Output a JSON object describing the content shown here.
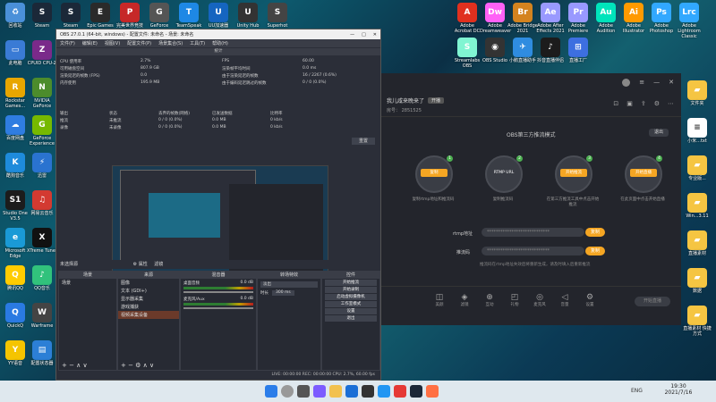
{
  "desktop_left": [
    {
      "label": "回收站",
      "color": "#4a90d9",
      "glyph": "♻"
    },
    {
      "label": "Steam",
      "color": "#1b2838",
      "glyph": "S"
    },
    {
      "label": "此电脑",
      "color": "#3a7bd5",
      "glyph": "▭"
    },
    {
      "label": "CPUID CPU-Z",
      "color": "#7a2a8a",
      "glyph": "Z"
    },
    {
      "label": "Rockstar Games...",
      "color": "#e8a600",
      "glyph": "R"
    },
    {
      "label": "NVIDIA GeForce",
      "color": "#4c8c2c",
      "glyph": "N"
    },
    {
      "label": "百度网盘",
      "color": "#2f7de1",
      "glyph": "☁"
    },
    {
      "label": "GeForce Experience",
      "color": "#76b900",
      "glyph": "G"
    },
    {
      "label": "酷狗音乐",
      "color": "#1e8bdb",
      "glyph": "K"
    },
    {
      "label": "迅雷",
      "color": "#2a73d0",
      "glyph": "⚡"
    },
    {
      "label": "Studio One V3.5",
      "color": "#1c1c1c",
      "glyph": "S1"
    },
    {
      "label": "网易云音乐",
      "color": "#d33a31",
      "glyph": "♫"
    },
    {
      "label": "Microsoft Edge",
      "color": "#1a9ad6",
      "glyph": "e"
    },
    {
      "label": "XTreme Tuner",
      "color": "#111",
      "glyph": "X"
    },
    {
      "label": "腾讯QQ",
      "color": "#ffcc00",
      "glyph": "Q"
    },
    {
      "label": "QQ音乐",
      "color": "#31c27c",
      "glyph": "♪"
    },
    {
      "label": "QuickQ",
      "color": "#2a7ae2",
      "glyph": "Q"
    },
    {
      "label": "Warframe",
      "color": "#444",
      "glyph": "W"
    },
    {
      "label": "YY语音",
      "color": "#f5c400",
      "glyph": "Y"
    },
    {
      "label": "配置状态器",
      "color": "#2c7fd6",
      "glyph": "▤"
    }
  ],
  "desktop_top": [
    {
      "label": "Steam",
      "color": "#1b2838",
      "glyph": "S"
    },
    {
      "label": "Epic Games",
      "color": "#2a2a2a",
      "glyph": "E"
    },
    {
      "label": "完美世界竞技平台",
      "color": "#c62828",
      "glyph": "P"
    },
    {
      "label": "GeForce",
      "color": "#555",
      "glyph": "G"
    },
    {
      "label": "TeamSpeak",
      "color": "#1e88e5",
      "glyph": "T"
    },
    {
      "label": "UU加速器",
      "color": "#1565c0",
      "glyph": "U"
    },
    {
      "label": "Unity Hub",
      "color": "#333",
      "glyph": "U"
    },
    {
      "label": "Superhot",
      "color": "#444",
      "glyph": "S"
    }
  ],
  "desktop_right_top": [
    {
      "label": "Adobe Acrobat DC",
      "color": "#e0301e",
      "glyph": "A"
    },
    {
      "label": "Adobe Dreamweaver",
      "color": "#ff61f6",
      "glyph": "Dw"
    },
    {
      "label": "Adobe Bridge 2021",
      "color": "#d4831f",
      "glyph": "Br"
    },
    {
      "label": "Adobe After Effects 2021",
      "color": "#9999ff",
      "glyph": "Ae"
    },
    {
      "label": "Adobe Premiere",
      "color": "#9999ff",
      "glyph": "Pr"
    },
    {
      "label": "Adobe Audition",
      "color": "#00e4bb",
      "glyph": "Au"
    },
    {
      "label": "Adobe Illustrator",
      "color": "#ff9a00",
      "glyph": "Ai"
    },
    {
      "label": "Adobe Photoshop",
      "color": "#31a8ff",
      "glyph": "Ps"
    },
    {
      "label": "Adobe Lightroom Classic",
      "color": "#31a8ff",
      "glyph": "Lrc"
    }
  ],
  "desktop_right_row2": [
    {
      "label": "Streamlabs OBS",
      "color": "#80f5d2",
      "glyph": "S"
    },
    {
      "label": "OBS Studio",
      "color": "#333",
      "glyph": "◉"
    },
    {
      "label": "小鹅直播助手",
      "color": "#2f8ce0",
      "glyph": "✈"
    },
    {
      "label": "抖音直播伴侣",
      "color": "#1c1c1c",
      "glyph": "♪"
    },
    {
      "label": "直播工厂",
      "color": "#3d6fe0",
      "glyph": "⊞"
    }
  ],
  "obs": {
    "title": "OBS 27.0.1 (64-bit, windows) - 配置文件: 未命名 - 场景: 未命名",
    "menu": [
      "文件(F)",
      "编辑(E)",
      "视图(V)",
      "配置文件(P)",
      "场景集合(S)",
      "工具(T)",
      "帮助(H)"
    ],
    "stats_header": "统计",
    "stats_left": [
      [
        "CPU 使用率",
        "2.7%"
      ],
      [
        "可用磁盘空间",
        "807.9 GB"
      ],
      [
        "渲染延迟的帧数 (FPS)",
        "0.0"
      ],
      [
        "内存使用",
        "195.9 MB"
      ]
    ],
    "stats_right": [
      [
        "FPS",
        "60.00"
      ],
      [
        "渲染帧平均时间",
        "0.0 ms"
      ],
      [
        "由于渲染延迟的帧数",
        "16 / 2267 (0.6%)"
      ],
      [
        "由于编码延迟跳过的帧数",
        "0 / 0 (0.0%)"
      ]
    ],
    "table_headers": [
      "输出",
      "状态",
      "丢弃的帧数(网络)",
      "已发送数据",
      "比特率"
    ],
    "table_rows": [
      [
        "推流",
        "未推流",
        "0 / 0 (0.0%)",
        "0.0 MB",
        "0 kb/s"
      ],
      [
        "录像",
        "未录像",
        "0 / 0 (0.0%)",
        "0.0 MB",
        "0 kb/s"
      ]
    ],
    "reset_label": "重置",
    "scene_bar_label": "未选择源",
    "props_label": "属性",
    "filters_label": "滤镜",
    "dock_scenes": "场景",
    "dock_sources": "来源",
    "dock_mixer": "混音器",
    "dock_transitions": "转场特效",
    "dock_controls": "控件",
    "scenes": [
      "场景"
    ],
    "sources": [
      "图像",
      "文本 (GDI+)",
      "显示器采集",
      "游戏捕获",
      "视频采集设备"
    ],
    "mixer": [
      {
        "name": "桌面音频",
        "db": "0.0 dB"
      },
      {
        "name": "麦克风/Aux",
        "db": "0.0 dB"
      }
    ],
    "transition_value": "淡出",
    "duration_label": "时长",
    "duration_value": "300 ms",
    "controls": [
      "开始推流",
      "开始录制",
      "启动虚拟摄像机",
      "工作室模式",
      "设置",
      "退出"
    ],
    "status": "LIVE: 00:00:00   REC: 00:00:00   CPU: 2.7%, 60.00 fps"
  },
  "app": {
    "title": "我儿咸来晚来了",
    "badge": "开播",
    "room_label": "房号：",
    "room": "2851525",
    "mode_title": "OBS第三方推流模式",
    "exit_label": "退出",
    "steps": [
      {
        "btn": "复制",
        "sub": "复制rtmp地址和推流码",
        "num": "1"
      },
      {
        "btn": "RTMP URL",
        "sub": "复制推流码",
        "num": "2"
      },
      {
        "btn": "开始推流",
        "sub": "在第三方推流工具中点击开始推流",
        "num": "3"
      },
      {
        "btn": "开始直播",
        "sub": "在此页面中点击开始直播",
        "num": "4"
      }
    ],
    "rtmp_label": "rtmp地址",
    "rtmp_value": "****************************",
    "key_label": "推流码",
    "key_value": "****************************",
    "copy_label": "复制",
    "hint": "推流码在rtmp地址失效后将重新生成，请及时填入后重新推流",
    "tools": [
      "美颜",
      "滤镜",
      "互动",
      "礼物",
      "麦克风",
      "音量",
      "设置"
    ],
    "start_label": "开始直播"
  },
  "desktop_right_col": [
    {
      "label": "文件夹",
      "color": "#f5c542",
      "glyph": "▰"
    },
    {
      "label": "小米...txt",
      "color": "#fff",
      "glyph": "≡"
    },
    {
      "label": "专业版...",
      "color": "#f5c542",
      "glyph": "▰"
    },
    {
      "label": "Win...3.11",
      "color": "#f5c542",
      "glyph": "▰"
    },
    {
      "label": "直播素材",
      "color": "#f5c542",
      "glyph": "▰"
    },
    {
      "label": "数据",
      "color": "#f5c542",
      "glyph": "▰"
    },
    {
      "label": "直播素材 快捷方式",
      "color": "#f5c542",
      "glyph": "▰"
    }
  ],
  "taskbar": {
    "time": "19:30",
    "date": "2021/7/16",
    "lang": "ENG"
  }
}
